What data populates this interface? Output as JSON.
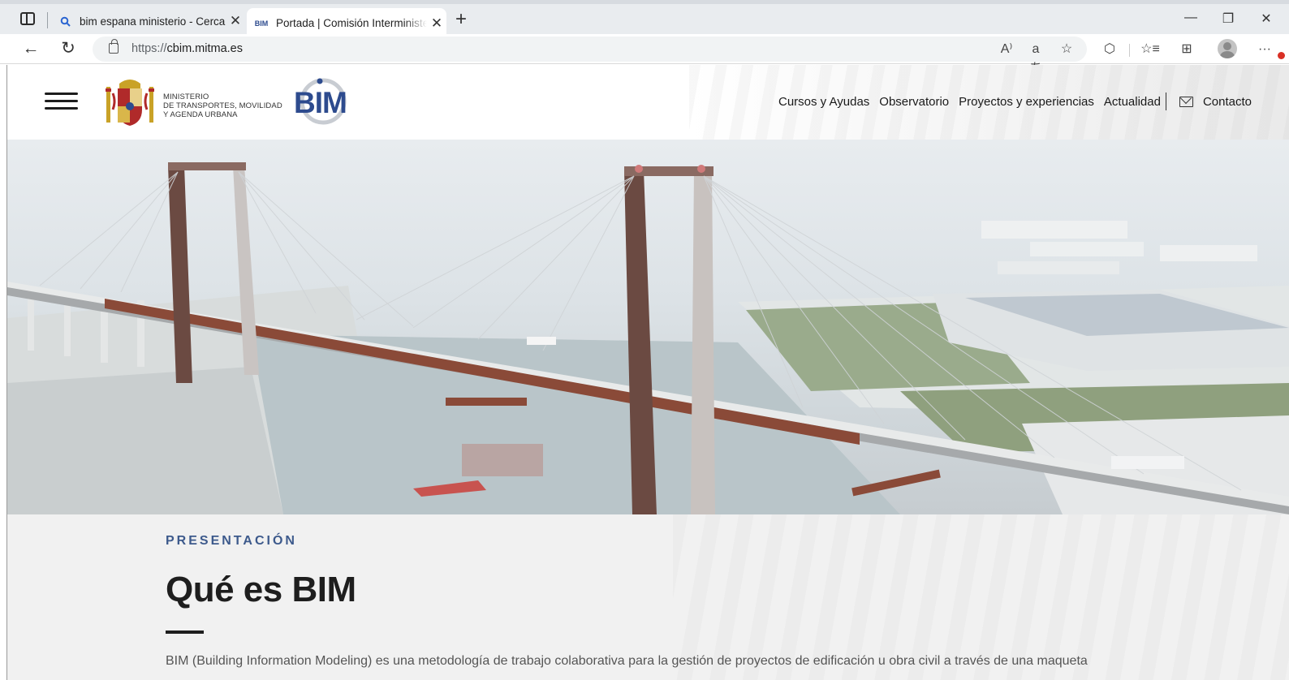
{
  "browser": {
    "tabs": [
      {
        "title": "bim espana ministerio - Cerca",
        "favicon": "search-icon",
        "active": false
      },
      {
        "title": "Portada | Comisión Interministerial BIM",
        "favicon": "BIM",
        "active": true
      }
    ],
    "url_prefix": "https://",
    "url_host": "cbim.mitma.es"
  },
  "site": {
    "ministry_lines": [
      "MINISTERIO",
      "DE TRANSPORTES, MOVILIDAD",
      "Y AGENDA URBANA"
    ],
    "logo_text": "BIM",
    "nav": [
      "Cursos y Ayudas",
      "Observatorio",
      "Proyectos y experiencias",
      "Actualidad"
    ],
    "contact_label": "Contacto"
  },
  "content": {
    "eyebrow": "PRESENTACIÓN",
    "heading": "Qué es BIM",
    "intro": "BIM (Building Information Modeling) es una metodología de trabajo colaborativa para la gestión de proyectos de edificación u obra civil a través de una maqueta"
  },
  "colors": {
    "accent": "#3d5a8c",
    "logo_blue": "#2d4b8e",
    "pylon": "#6b4a42",
    "deck_rust": "#8a4a38"
  }
}
